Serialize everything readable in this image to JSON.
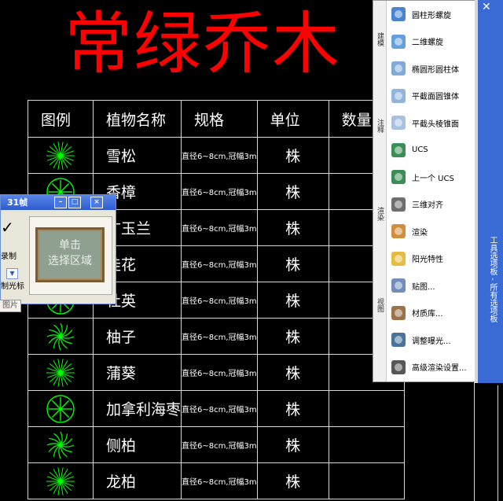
{
  "title": "常绿乔木",
  "table": {
    "headers": [
      "图例",
      "植物名称",
      "规格",
      "单位",
      "数量"
    ],
    "rows": [
      {
        "name": "雪松",
        "spec": "直径6~8cm,冠幅3m",
        "unit": "株"
      },
      {
        "name": "香樟",
        "spec": "直径6~8cm,冠幅3m",
        "unit": "株"
      },
      {
        "name": "广玉兰",
        "spec": "直径6~8cm,冠幅3m",
        "unit": "株"
      },
      {
        "name": "桂花",
        "spec": "直径6~8cm,冠幅3m",
        "unit": "株"
      },
      {
        "name": "杜英",
        "spec": "直径6~8cm,冠幅3m",
        "unit": "株"
      },
      {
        "name": "柚子",
        "spec": "直径6~8cm,冠幅3m",
        "unit": "株"
      },
      {
        "name": "蒲葵",
        "spec": "直径6~8cm,冠幅3m",
        "unit": "株"
      },
      {
        "name": "加拿利海枣",
        "spec": "直径6~8cm,冠幅3m",
        "unit": "株"
      },
      {
        "name": "侧柏",
        "spec": "直径6~8cm,冠幅3m",
        "unit": "株"
      },
      {
        "name": "龙柏",
        "spec": "直径6~8cm,冠幅3m",
        "unit": "株"
      }
    ]
  },
  "popup": {
    "title": "31帧",
    "preview_line1": "单击",
    "preview_line2": "选择区域",
    "frag1": "录制",
    "frag2": "制光标",
    "btn": "图片"
  },
  "palette": {
    "tabs": [
      "建模",
      "注释",
      "渲染",
      "视图"
    ],
    "items": [
      "圆柱形螺旋",
      "二维螺旋",
      "椭圆形圆柱体",
      "平截面圆锥体",
      "平截头棱锥面",
      "UCS",
      "上一个 UCS",
      "三维对齐",
      "渲染",
      "阳光特性",
      "贴图...",
      "材质库...",
      "调整曝光...",
      "高级渲染设置..."
    ],
    "side_title": "工具选项板 - 所有选项板"
  },
  "colors": {
    "title": "#ff0000",
    "symbol": "#00ff00",
    "grid": "#d8d8d8",
    "palette_bar": "#3a6bd4"
  }
}
